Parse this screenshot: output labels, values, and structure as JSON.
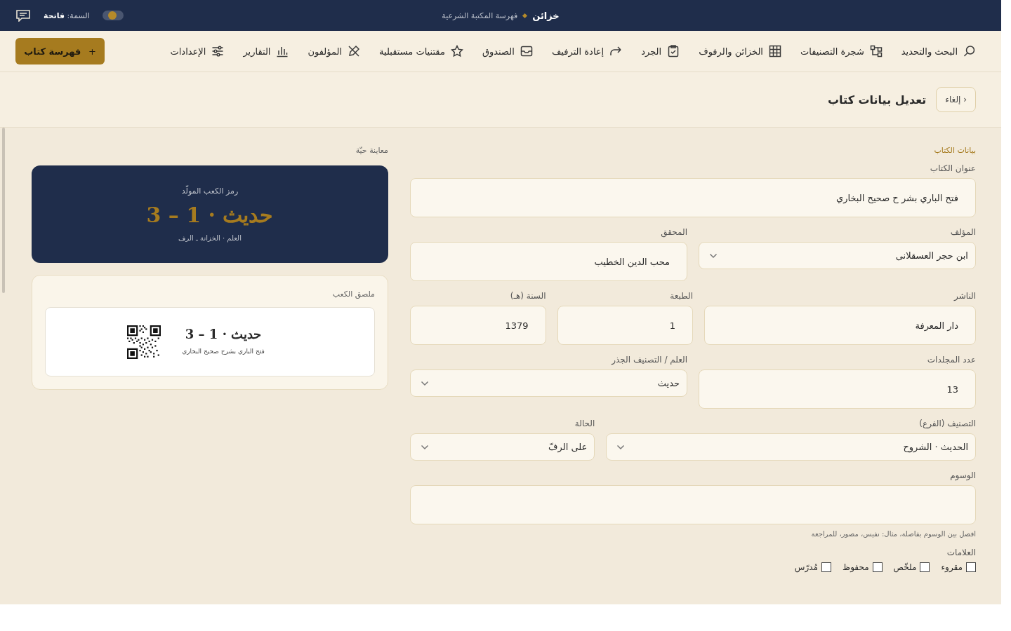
{
  "topbar": {
    "brand": "خزائن",
    "subtitle": "فهرسة المكتبة الشرعية",
    "theme_label": "السمة:",
    "theme_value": "فاتحة",
    "theme_toggle": {
      "on": false
    }
  },
  "nav": [
    {
      "label": "البحث والتحديد",
      "selected": false
    },
    {
      "label": "شجرة التصنيفات",
      "selected": false
    },
    {
      "label": "الخزائن والرفوف",
      "selected": false
    },
    {
      "label": "الجرد",
      "selected": false
    },
    {
      "label": "إعادة الترفيف",
      "selected": false
    },
    {
      "label": "الصندوق",
      "selected": false
    },
    {
      "label": "مقتنيات مستقبلية",
      "selected": false
    },
    {
      "label": "المؤلفون",
      "selected": false
    },
    {
      "label": "التقارير",
      "selected": false
    },
    {
      "label": "الإعدادات",
      "selected": false
    }
  ],
  "add_button": {
    "icon": "+",
    "label": "فهرسة كتاب"
  },
  "header": {
    "cancel": {
      "icon": "‹",
      "label": "إلغاء"
    },
    "title": "تعديل بيانات كتاب"
  },
  "form": {
    "section": "بيانات الكتاب",
    "rows": [
      [
        {
          "label": "عنوان الكتاب",
          "kind": "input",
          "value": "فتح الباري بشر ح صحيح البخاري"
        }
      ],
      [
        {
          "label": "المؤلف",
          "kind": "select",
          "value": "ابن حجر العسقلانى"
        },
        {
          "label": "المحقق",
          "kind": "input",
          "value": "محب الدين الخطيب"
        }
      ],
      [
        {
          "label": "الناشر",
          "kind": "input",
          "value": "دار المعرفة"
        },
        {
          "label": "الطبعة",
          "kind": "input",
          "value": "1"
        },
        {
          "label": "السنة (هـ)",
          "kind": "input",
          "value": "1379"
        }
      ],
      [
        {
          "label": "عدد المجلدات",
          "kind": "input",
          "value": "13"
        },
        {
          "label": "العلم / التصنيف الجذر",
          "kind": "select",
          "value": "حديث"
        }
      ],
      [
        {
          "label": "التصنيف (الفرع)",
          "kind": "select",
          "value": "الحديث · الشروح"
        },
        {
          "label": "الحالة",
          "kind": "select",
          "value": "على الرفّ"
        }
      ],
      [
        {
          "label": "الوسوم",
          "kind": "input",
          "hint": "افصل بين الوسوم بفاصلة، مثال: نفيس، مصور، للمراجعة"
        }
      ]
    ],
    "marks_label": "العلامات",
    "marks": [
      {
        "label": "مقروء",
        "checked": false
      },
      {
        "label": "ملخّص",
        "checked": false
      },
      {
        "label": "محفوظ",
        "checked": false
      },
      {
        "label": "مُدرّس",
        "checked": false
      }
    ]
  },
  "preview": {
    "label": "معاينة حيّة",
    "card": {
      "caption": "رمز الكعب المولّد",
      "code": "حديث · 1 – 3",
      "path": "العلم · الخزانة ـ الرف"
    },
    "spine": {
      "label": "ملصق الكعب",
      "code": "حديث · 1 – 3",
      "title": "فتح الباري بشرح صحيح البخاري"
    }
  }
}
